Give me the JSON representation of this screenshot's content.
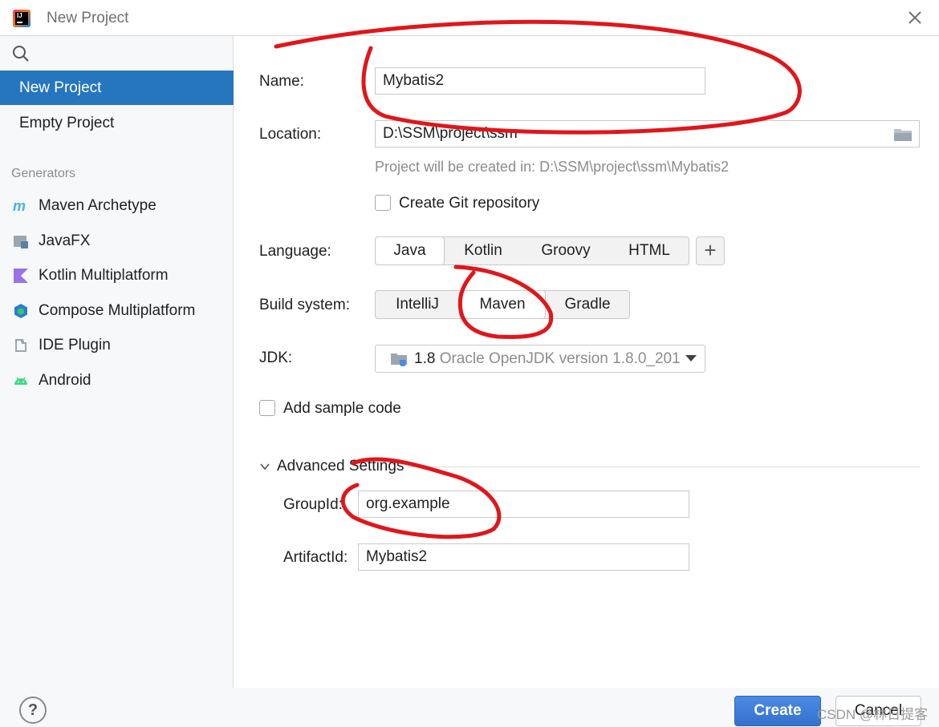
{
  "window": {
    "title": "New Project"
  },
  "sidebar": {
    "items": [
      {
        "label": "New Project",
        "selected": true
      },
      {
        "label": "Empty Project",
        "selected": false
      }
    ],
    "generators_header": "Generators",
    "generators": [
      {
        "label": "Maven Archetype",
        "icon": "maven-icon"
      },
      {
        "label": "JavaFX",
        "icon": "javafx-icon"
      },
      {
        "label": "Kotlin Multiplatform",
        "icon": "kotlin-icon"
      },
      {
        "label": "Compose Multiplatform",
        "icon": "compose-icon"
      },
      {
        "label": "IDE Plugin",
        "icon": "plugin-icon"
      },
      {
        "label": "Android",
        "icon": "android-icon"
      }
    ]
  },
  "form": {
    "name": {
      "label": "Name:",
      "value": "Mybatis2"
    },
    "location": {
      "label": "Location:",
      "value": "D:\\SSM\\project\\ssm",
      "hint": "Project will be created in: D:\\SSM\\project\\ssm\\Mybatis2"
    },
    "git": {
      "label": "Create Git repository",
      "checked": false
    },
    "language": {
      "label": "Language:",
      "options": [
        "Java",
        "Kotlin",
        "Groovy",
        "HTML"
      ],
      "selected": "Java"
    },
    "build_system": {
      "label": "Build system:",
      "options": [
        "IntelliJ",
        "Maven",
        "Gradle"
      ],
      "selected": "Maven"
    },
    "jdk": {
      "label": "JDK:",
      "version": "1.8",
      "description": "Oracle OpenJDK version 1.8.0_201"
    },
    "sample_code": {
      "label": "Add sample code",
      "checked": false
    },
    "advanced": {
      "label": "Advanced Settings",
      "group_id": {
        "label": "GroupId:",
        "value": "org.example"
      },
      "artifact_id": {
        "label": "ArtifactId:",
        "value": "Mybatis2"
      }
    }
  },
  "footer": {
    "help_label": "?",
    "create_label": "Create",
    "cancel_label": "Cancel",
    "watermark": "CSDN @林日提客"
  },
  "colors": {
    "accent": "#2675bf",
    "primary_button": "#3471cc",
    "annotation": "#e0161b"
  }
}
